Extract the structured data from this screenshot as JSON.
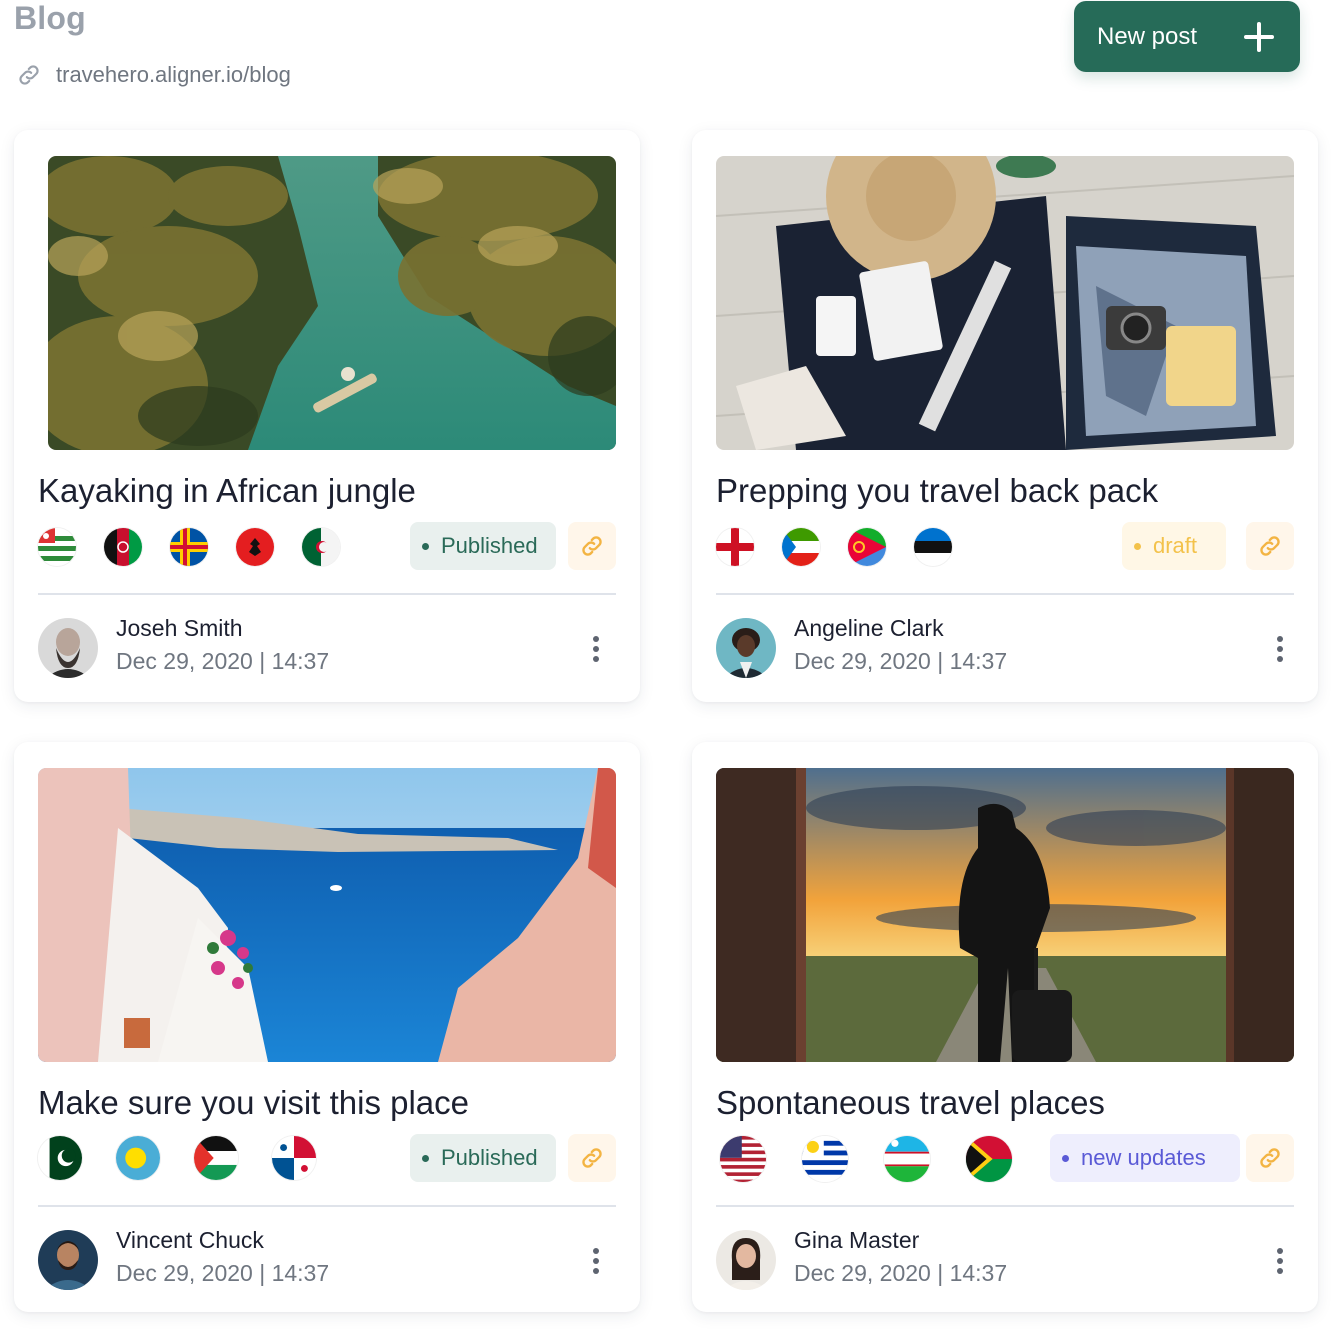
{
  "header": {
    "title": "Blog",
    "url": "travehero.aligner.io/blog",
    "new_post_label": "New post"
  },
  "posts": [
    {
      "title": "Kayaking in African jungle",
      "status": "Published",
      "author": "Joseh Smith",
      "date": "Dec 29, 2020 | 14:37",
      "image": "river-jungle-kayak",
      "flags": [
        "abkhazia-flag",
        "afghanistan-flag",
        "aland-flag",
        "albania-flag",
        "algeria-flag"
      ]
    },
    {
      "title": "Prepping you travel back pack",
      "status": "draft",
      "author": "Angeline Clark",
      "date": "Dec 29, 2020 | 14:37",
      "image": "packed-suitcase",
      "flags": [
        "england-flag",
        "equatorial-guinea-flag",
        "eritrea-flag",
        "estonia-flag"
      ]
    },
    {
      "title": "Make sure you visit this place",
      "status": "Published",
      "author": "Vincent Chuck",
      "date": "Dec 29, 2020 | 14:37",
      "image": "santorini-sea-view",
      "flags": [
        "pakistan-flag",
        "palau-flag",
        "palestine-flag",
        "panama-flag"
      ]
    },
    {
      "title": "Spontaneous travel places",
      "status": "new updates",
      "author": "Gina Master",
      "date": "Dec 29, 2020 | 14:37",
      "image": "traveler-sunset-doorway",
      "flags": [
        "usa-flag",
        "uruguay-flag",
        "uzbekistan-flag",
        "vanuatu-flag"
      ]
    }
  ],
  "colors": {
    "primary": "#266b58",
    "published_bg": "#e9f0ee",
    "draft_text": "#f3c24b",
    "updates_text": "#5a5ad6",
    "link_icon": "#f3b443"
  }
}
